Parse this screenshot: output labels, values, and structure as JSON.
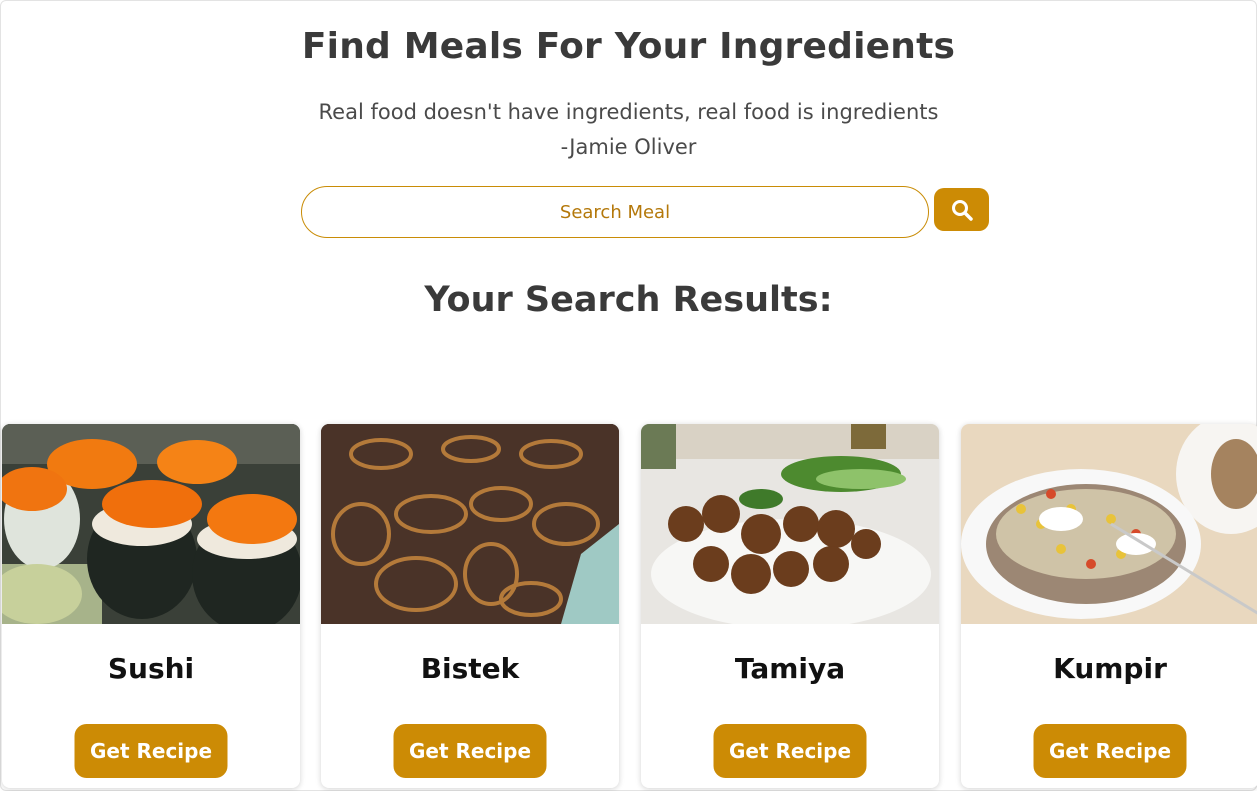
{
  "header": {
    "title": "Find Meals For Your Ingredients",
    "quote_line1": "Real food doesn't have ingredients, real food is ingredients",
    "quote_line2": "-Jamie Oliver"
  },
  "search": {
    "placeholder": "Search Meal",
    "value": "",
    "button_icon": "search-icon"
  },
  "results": {
    "title": "Your Search Results:",
    "meals": [
      {
        "name": "Sushi",
        "button_label": "Get Recipe"
      },
      {
        "name": "Bistek",
        "button_label": "Get Recipe"
      },
      {
        "name": "Tamiya",
        "button_label": "Get Recipe"
      },
      {
        "name": "Kumpir",
        "button_label": "Get Recipe"
      }
    ]
  },
  "colors": {
    "accent": "#cc8b05",
    "heading": "#3a3a3a",
    "text": "#4a4a4a"
  }
}
